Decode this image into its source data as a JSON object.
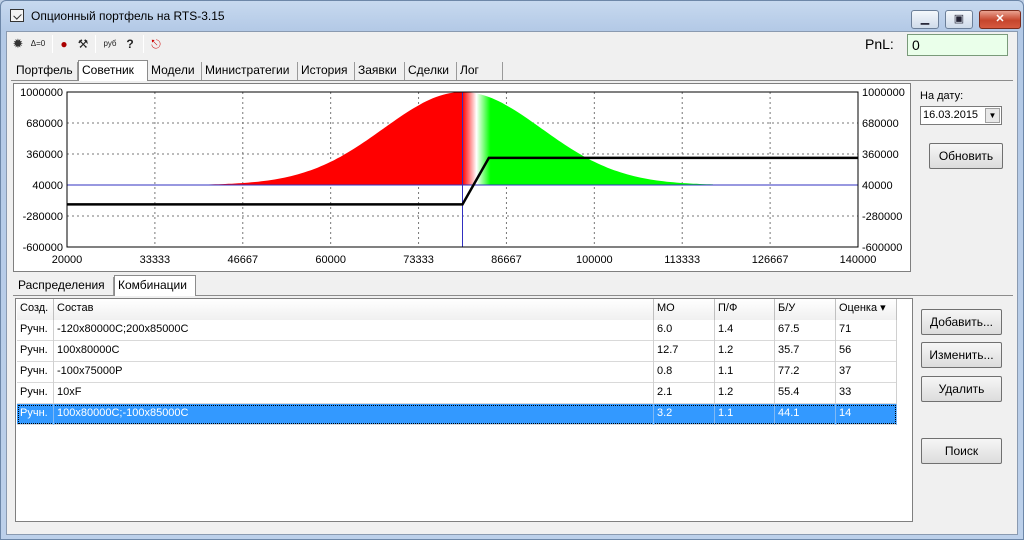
{
  "window": {
    "title": "Опционный портфель на RTS-3.15",
    "minimize_icon": "minimize-icon",
    "maximize_icon": "maximize-icon",
    "close_icon": "close-icon"
  },
  "toolbar": {
    "items": [
      {
        "icon": "gear-icon",
        "text": ""
      },
      {
        "icon": "delta-zero-icon",
        "text": "Δ=0"
      },
      {
        "icon": "piggy-icon",
        "text": ""
      },
      {
        "icon": "wrench-icon",
        "text": ""
      },
      {
        "icon": "rub-icon",
        "text": "руб"
      },
      {
        "icon": "help-icon",
        "text": "?"
      },
      {
        "icon": "exit-icon",
        "text": ""
      }
    ],
    "pnl_label": "PnL:",
    "pnl_value": "0"
  },
  "tabs": [
    "Портфель",
    "Советник",
    "Модели",
    "Министратегии",
    "История",
    "Заявки",
    "Сделки",
    "Лог"
  ],
  "active_tab": "Советник",
  "side": {
    "date_label": "На дату:",
    "date_value": "16.03.2015",
    "refresh_label": "Обновить"
  },
  "subtabs": [
    "Распределения",
    "Комбинации"
  ],
  "active_subtab": "Комбинации",
  "table": {
    "columns": [
      "Созд.",
      "Состав",
      "МО",
      "П/Ф",
      "Б/У",
      "Оценка"
    ],
    "sort_indicator": "▾",
    "rows": [
      [
        "Ручн.",
        "-120x80000C;200x85000C",
        "6.0",
        "1.4",
        "67.5",
        "71"
      ],
      [
        "Ручн.",
        "100x80000C",
        "12.7",
        "1.2",
        "35.7",
        "56"
      ],
      [
        "Ручн.",
        "-100x75000P",
        "0.8",
        "1.1",
        "77.2",
        "37"
      ],
      [
        "Ручн.",
        "10xF",
        "2.1",
        "1.2",
        "55.4",
        "33"
      ],
      [
        "Ручн.",
        "100x80000C;-100x85000C",
        "3.2",
        "1.1",
        "44.1",
        "14"
      ]
    ],
    "selected_row": 4
  },
  "buttons": {
    "add": "Добавить...",
    "edit": "Изменить...",
    "delete": "Удалить",
    "search": "Поиск"
  },
  "chart_data": {
    "type": "area",
    "xlim": [
      20000,
      140000
    ],
    "ylim": [
      -600000,
      1000000
    ],
    "x_ticks": [
      "20000",
      "33333",
      "46667",
      "60000",
      "73333",
      "86667",
      "100000",
      "113333",
      "126667",
      "140000"
    ],
    "y_ticks": [
      "1000000",
      "680000",
      "360000",
      "40000",
      "-280000",
      "-600000"
    ],
    "grid": true,
    "distribution": {
      "mean": 80000,
      "sd": 12000,
      "peak": 1000000,
      "left_color": "#ff0000",
      "right_color": "#00ff00",
      "x_range": [
        27000,
        118000
      ]
    },
    "baseline": 40000,
    "current_price": 80000,
    "payoff": {
      "x": [
        20000,
        80000,
        84000,
        140000
      ],
      "y": [
        -160000,
        -160000,
        320000,
        320000
      ]
    }
  }
}
